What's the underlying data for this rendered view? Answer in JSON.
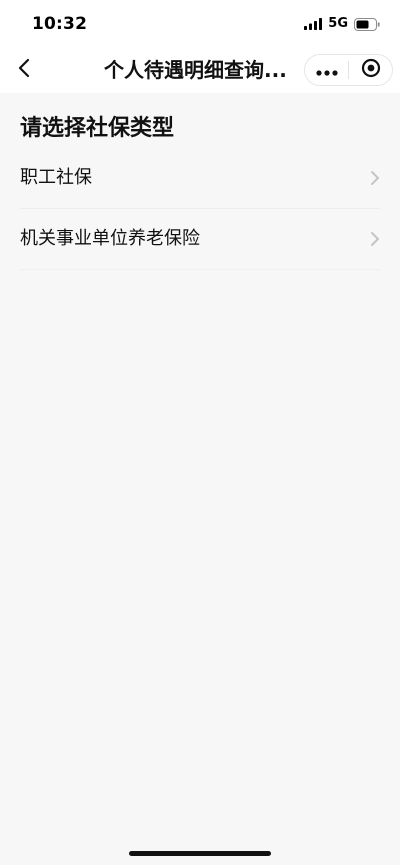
{
  "status_bar": {
    "time": "10:32",
    "network": "5G",
    "icons": [
      "signal-icon",
      "battery-icon"
    ]
  },
  "nav": {
    "title": "个人待遇明细查询...",
    "icons": [
      "chevron-left-icon",
      "more-dots-icon",
      "target-circle-icon"
    ]
  },
  "page": {
    "section_title": "请选择社保类型",
    "options": [
      {
        "label": "职工社保"
      },
      {
        "label": "机关事业单位养老保险"
      }
    ]
  },
  "colors": {
    "background": "#f7f7f7",
    "surface": "#ffffff",
    "text": "#111111",
    "chevron": "#c4c4c4",
    "divider": "#ececec"
  }
}
